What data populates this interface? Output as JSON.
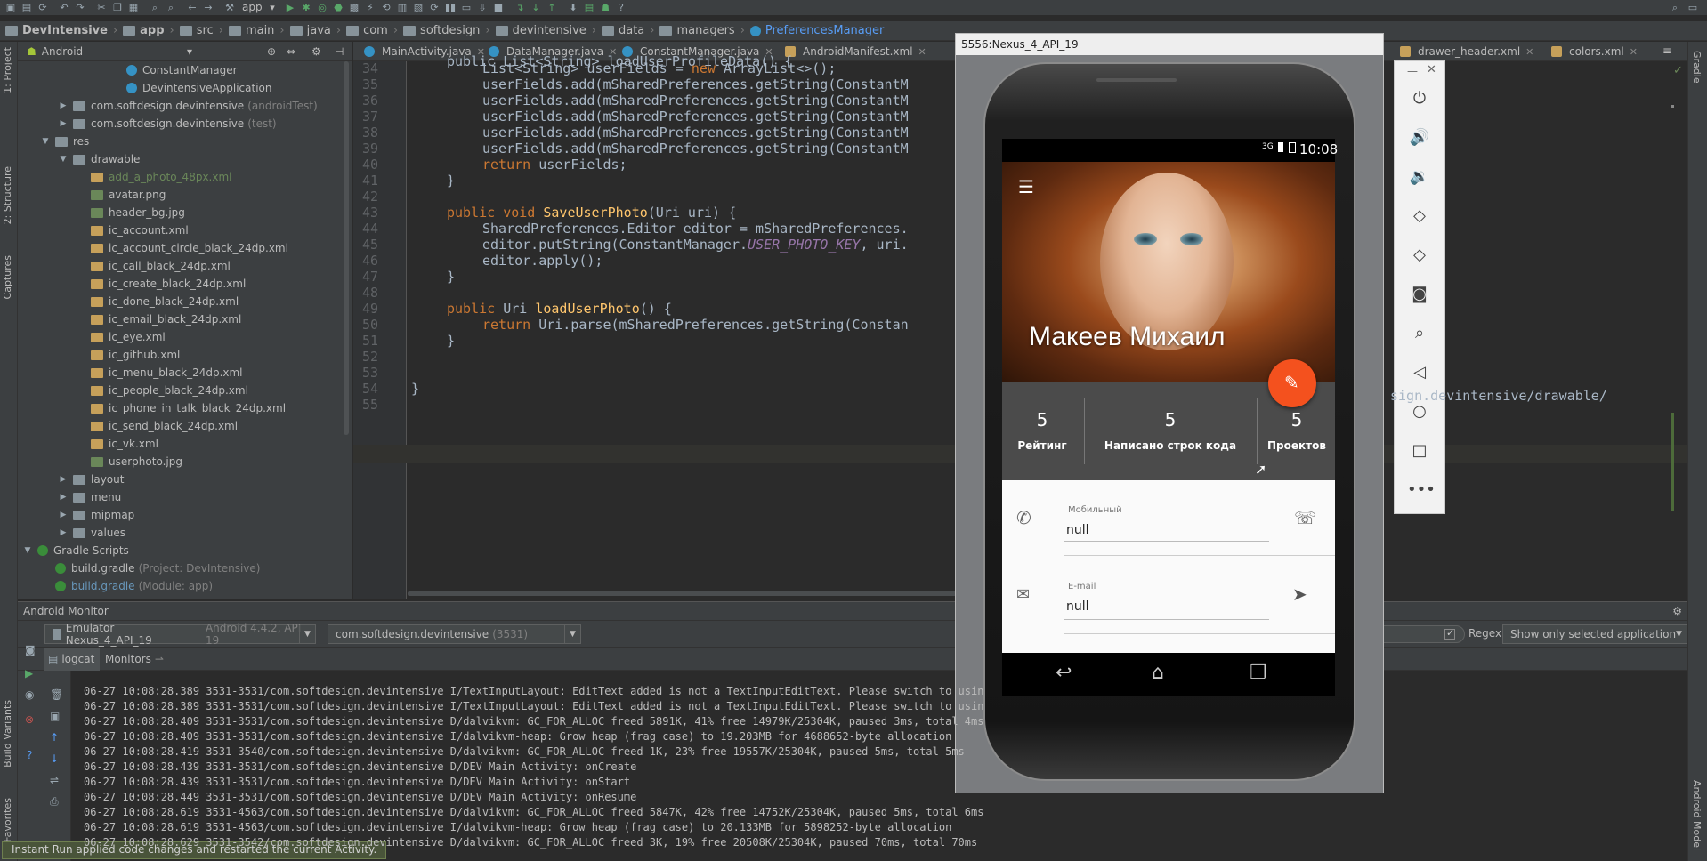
{
  "toolbar": {
    "run_config": "app"
  },
  "breadcrumbs": [
    "DevIntensive",
    "app",
    "src",
    "main",
    "java",
    "com",
    "softdesign",
    "devintensive",
    "data",
    "managers",
    "PreferencesManager"
  ],
  "project_panel": {
    "view_selector": "Android",
    "tree": [
      {
        "label": "ConstantManager",
        "kind": "cls",
        "indent": 5
      },
      {
        "label": "DevintensiveApplication",
        "kind": "cls",
        "indent": 5
      },
      {
        "label": "com.softdesign.devintensive",
        "suffix": "(androidTest)",
        "kind": "folder",
        "indent": 2,
        "arrow": "▶"
      },
      {
        "label": "com.softdesign.devintensive",
        "suffix": "(test)",
        "kind": "folder",
        "indent": 2,
        "arrow": "▶"
      },
      {
        "label": "res",
        "kind": "folder",
        "indent": 1,
        "arrow": "▼"
      },
      {
        "label": "drawable",
        "kind": "folder",
        "indent": 2,
        "arrow": "▼"
      },
      {
        "label": "add_a_photo_48px.xml",
        "kind": "xml",
        "indent": 3,
        "color": "#6a8759"
      },
      {
        "label": "avatar.png",
        "kind": "img",
        "indent": 3
      },
      {
        "label": "header_bg.jpg",
        "kind": "img",
        "indent": 3
      },
      {
        "label": "ic_account.xml",
        "kind": "xml",
        "indent": 3
      },
      {
        "label": "ic_account_circle_black_24dp.xml",
        "kind": "xml",
        "indent": 3
      },
      {
        "label": "ic_call_black_24dp.xml",
        "kind": "xml",
        "indent": 3
      },
      {
        "label": "ic_create_black_24dp.xml",
        "kind": "xml",
        "indent": 3
      },
      {
        "label": "ic_done_black_24dp.xml",
        "kind": "xml",
        "indent": 3
      },
      {
        "label": "ic_email_black_24dp.xml",
        "kind": "xml",
        "indent": 3
      },
      {
        "label": "ic_eye.xml",
        "kind": "xml",
        "indent": 3
      },
      {
        "label": "ic_github.xml",
        "kind": "xml",
        "indent": 3
      },
      {
        "label": "ic_menu_black_24dp.xml",
        "kind": "xml",
        "indent": 3
      },
      {
        "label": "ic_people_black_24dp.xml",
        "kind": "xml",
        "indent": 3
      },
      {
        "label": "ic_phone_in_talk_black_24dp.xml",
        "kind": "xml",
        "indent": 3
      },
      {
        "label": "ic_send_black_24dp.xml",
        "kind": "xml",
        "indent": 3
      },
      {
        "label": "ic_vk.xml",
        "kind": "xml",
        "indent": 3
      },
      {
        "label": "userphoto.jpg",
        "kind": "img",
        "indent": 3
      },
      {
        "label": "layout",
        "kind": "folder",
        "indent": 2,
        "arrow": "▶"
      },
      {
        "label": "menu",
        "kind": "folder",
        "indent": 2,
        "arrow": "▶"
      },
      {
        "label": "mipmap",
        "kind": "folder",
        "indent": 2,
        "arrow": "▶"
      },
      {
        "label": "values",
        "kind": "folder",
        "indent": 2,
        "arrow": "▶"
      },
      {
        "label": "Gradle Scripts",
        "kind": "grad",
        "indent": 0,
        "arrow": "▼"
      },
      {
        "label": "build.gradle",
        "suffix": "(Project: DevIntensive)",
        "kind": "grad",
        "indent": 1
      },
      {
        "label": "build.gradle",
        "suffix": "(Module: app)",
        "kind": "grad",
        "indent": 1,
        "color": "#6897bb"
      }
    ]
  },
  "editor_tabs": [
    {
      "label": "MainActivity.java",
      "kind": "cls"
    },
    {
      "label": "DataManager.java",
      "kind": "cls"
    },
    {
      "label": "ConstantManager.java",
      "kind": "cls"
    },
    {
      "label": "AndroidManifest.xml",
      "kind": "xml"
    },
    {
      "label": "drawer_header.xml",
      "kind": "xml"
    },
    {
      "label": "colors.xml",
      "kind": "xml"
    }
  ],
  "code": {
    "line_numbers": [
      "34",
      "35",
      "36",
      "37",
      "38",
      "39",
      "40",
      "41",
      "42",
      "43",
      "44",
      "45",
      "46",
      "47",
      "48",
      "49",
      "50",
      "51",
      "52",
      "53",
      "54",
      "55"
    ],
    "lines": [
      {
        "segs": [
          [
            "ty",
            "List<String> userFields = "
          ],
          [
            "kw",
            "new "
          ],
          [
            "ty",
            "ArrayList<>();"
          ]
        ],
        "indent": 2
      },
      {
        "segs": [
          [
            "ty",
            "userFields.add(mSharedPreferences.getString(ConstantM"
          ]
        ],
        "indent": 2
      },
      {
        "segs": [
          [
            "ty",
            "userFields.add(mSharedPreferences.getString(ConstantM"
          ]
        ],
        "indent": 2
      },
      {
        "segs": [
          [
            "ty",
            "userFields.add(mSharedPreferences.getString(ConstantM"
          ]
        ],
        "indent": 2
      },
      {
        "segs": [
          [
            "ty",
            "userFields.add(mSharedPreferences.getString(ConstantM"
          ]
        ],
        "indent": 2
      },
      {
        "segs": [
          [
            "ty",
            "userFields.add(mSharedPreferences.getString(ConstantM"
          ]
        ],
        "indent": 2
      },
      {
        "segs": [
          [
            "kw",
            "return "
          ],
          [
            "ty",
            "userFields;"
          ]
        ],
        "indent": 2
      },
      {
        "segs": [
          [
            "ty",
            "}"
          ]
        ],
        "indent": 1
      },
      {
        "segs": [],
        "indent": 0
      },
      {
        "segs": [
          [
            "kw",
            "public void "
          ],
          [
            "fn",
            "SaveUserPhoto"
          ],
          [
            "ty",
            "(Uri uri) {"
          ]
        ],
        "indent": 1
      },
      {
        "segs": [
          [
            "ty",
            "SharedPreferences.Editor editor = mSharedPreferences."
          ]
        ],
        "indent": 2
      },
      {
        "segs": [
          [
            "ty",
            "editor.putString(ConstantManager."
          ],
          [
            "cst",
            "USER_PHOTO_KEY"
          ],
          [
            "ty",
            ", uri."
          ]
        ],
        "indent": 2
      },
      {
        "segs": [
          [
            "ty",
            "editor.apply();"
          ]
        ],
        "indent": 2
      },
      {
        "segs": [
          [
            "ty",
            "}"
          ]
        ],
        "indent": 1
      },
      {
        "segs": [],
        "indent": 0
      },
      {
        "segs": [
          [
            "kw",
            "public "
          ],
          [
            "ty",
            "Uri "
          ],
          [
            "fn",
            "loadUserPhoto"
          ],
          [
            "ty",
            "() {"
          ]
        ],
        "indent": 1
      },
      {
        "segs": [
          [
            "kw",
            "return "
          ],
          [
            "ty",
            "Uri.parse(mSharedPreferences.getString(Constan"
          ]
        ],
        "indent": 2
      },
      {
        "segs": [
          [
            "ty",
            "}"
          ]
        ],
        "indent": 1
      },
      {
        "segs": [],
        "indent": 0
      },
      {
        "segs": [],
        "indent": 0
      },
      {
        "segs": [
          [
            "ty",
            "}"
          ]
        ],
        "indent": 0
      },
      {
        "segs": [],
        "indent": 0
      }
    ],
    "header_partial": "public List<String> loadUserProfileData() {",
    "right_fragment": "sign.devintensive/drawable/"
  },
  "monitor": {
    "title": "Android Monitor",
    "device": "Emulator Nexus_4_API_19",
    "device_detail": "Android 4.4.2, API 19",
    "process": "com.softdesign.devintensive",
    "process_pid": "(3531)",
    "tab_logcat": "logcat",
    "tab_monitors": "Monitors",
    "regex_label": "Regex",
    "filter_option": "Show only selected application",
    "log_lines": [
      "06-27 10:08:28.389 3531-3531/com.softdesign.devintensive I/TextInputLayout: EditText added is not a TextInputEditText. Please switch to usin",
      "06-27 10:08:28.389 3531-3531/com.softdesign.devintensive I/TextInputLayout: EditText added is not a TextInputEditText. Please switch to usin",
      "06-27 10:08:28.409 3531-3531/com.softdesign.devintensive D/dalvikvm: GC_FOR_ALLOC freed 5891K, 41% free 14979K/25304K, paused 3ms, total 4ms",
      "06-27 10:08:28.409 3531-3531/com.softdesign.devintensive I/dalvikvm-heap: Grow heap (frag case) to 19.203MB for 4688652-byte allocation",
      "06-27 10:08:28.419 3531-3540/com.softdesign.devintensive D/dalvikvm: GC_FOR_ALLOC freed 1K, 23% free 19557K/25304K, paused 5ms, total 5ms",
      "06-27 10:08:28.439 3531-3531/com.softdesign.devintensive D/DEV Main Activity: onCreate",
      "06-27 10:08:28.439 3531-3531/com.softdesign.devintensive D/DEV Main Activity: onStart",
      "06-27 10:08:28.449 3531-3531/com.softdesign.devintensive D/DEV Main Activity: onResume",
      "06-27 10:08:28.619 3531-4563/com.softdesign.devintensive D/dalvikvm: GC_FOR_ALLOC freed 5847K, 42% free 14752K/25304K, paused 5ms, total 6ms",
      "06-27 10:08:28.619 3531-4563/com.softdesign.devintensive I/dalvikvm-heap: Grow heap (frag case) to 20.133MB for 5898252-byte allocation",
      "06-27 10:08:28.629 3531-3542/com.softdesign.devintensive D/dalvikvm: GC_FOR_ALLOC freed 3K, 19% free 20508K/25304K, paused 70ms, total 70ms"
    ]
  },
  "toast": "Instant Run applied code changes and restarted the current Activity.",
  "side_labels": {
    "project": "1: Project",
    "structure": "2: Structure",
    "captures": "Captures",
    "build_variants": "Build Variants",
    "favorites": "Favorites",
    "gradle": "Gradle",
    "android_model": "Android Model"
  },
  "emulator": {
    "title": "5556:Nexus_4_API_19",
    "status": {
      "signal": "3G",
      "time": "10:08"
    },
    "profile_name": "Макеев Михаил",
    "stats": [
      {
        "value": "5",
        "label": "Рейтинг"
      },
      {
        "value": "5",
        "label": "Написано строк кода"
      },
      {
        "value": "5",
        "label": "Проектов"
      }
    ],
    "phone_field": {
      "label": "Мобильный",
      "value": "null"
    },
    "email_field": {
      "label": "E-mail",
      "value": "null"
    },
    "side_buttons": [
      "power-icon",
      "volume-up-icon",
      "volume-down-icon",
      "rotate-left-icon",
      "rotate-right-icon",
      "camera-icon",
      "zoom-icon",
      "back-icon",
      "home-icon",
      "overview-icon",
      "more-icon"
    ]
  },
  "colors": {
    "fab": "#f4511e",
    "accent_green": "#6a8759",
    "link_blue": "#6897bb"
  }
}
